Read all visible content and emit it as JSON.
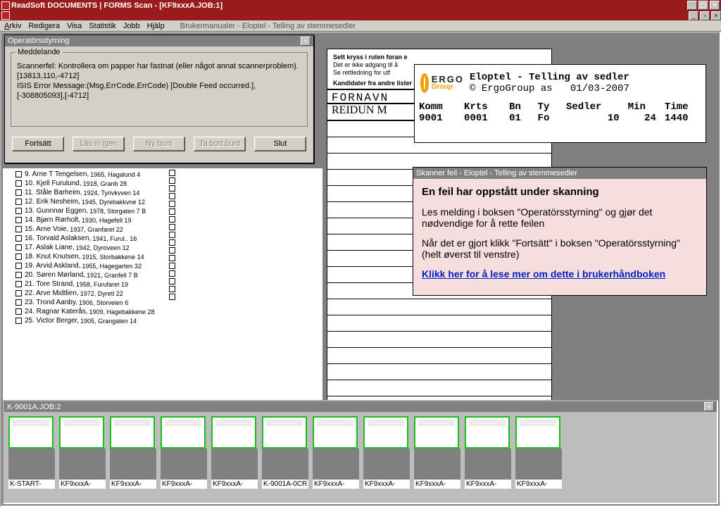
{
  "window": {
    "title": "ReadSoft DOCUMENTS | FORMS Scan - [KF9xxxA.JOB:1]"
  },
  "menu": {
    "arkiv": "Arkiv",
    "redigera": "Redigera",
    "visa": "Visa",
    "statistik": "Statistik",
    "jobb": "Jobb",
    "hjalp": "Hjälp",
    "help_trail": "Brukermanualer - Eloptel - Telling av stemmesedler"
  },
  "dialog": {
    "title": "Operatörsstyrning",
    "group_legend": "Meddelande",
    "msg1": "Scannerfel: Kontrollera om papper har fastnat (eller något annat scannerproblem).",
    "msg2": "[13813,110,-4712]",
    "msg3": "ISIS Error Message:(Msg,ErrCode,ErrCode) [Double Feed occurred.],[-308805093],[-4712]",
    "btn_fortsatt": "Fortsätt",
    "btn_lasin": "Läs in igen",
    "btn_nybunt": "Ny bunt",
    "btn_tabort": "Ta bort bunt",
    "btn_slut": "Slut"
  },
  "candidates": [
    {
      "n": "9",
      "name": "Arne T Tengelsen",
      "meta": "1965, Hagalund  4"
    },
    {
      "n": "10",
      "name": "Kjell Furulund",
      "meta": "1918, Granb  28"
    },
    {
      "n": "11",
      "name": "Ståle Barheim",
      "meta": "1924, Tyrivkvven  14"
    },
    {
      "n": "12",
      "name": "Erik Nesheim",
      "meta": "1945, Dyrebakkvne 12"
    },
    {
      "n": "13",
      "name": "Gunnnar Eggen",
      "meta": "1978, Storgaten  7 B"
    },
    {
      "n": "14",
      "name": "Bjørn Rørholt",
      "meta": "1930, Hagefell  19"
    },
    {
      "n": "15",
      "name": "Arne Voie",
      "meta": "1937, Granfaret  22"
    },
    {
      "n": "16",
      "name": "Torvald Aslaksen",
      "meta": "1941, Furul..  16"
    },
    {
      "n": "17",
      "name": "Aslak Liane",
      "meta": "1942, Dyroveen  12"
    },
    {
      "n": "18",
      "name": "Knut Knutsen",
      "meta": "1915, Storbakkene 14"
    },
    {
      "n": "19",
      "name": "Arvid Askland",
      "meta": "1955, Hagegarten  32"
    },
    {
      "n": "20",
      "name": "Søren Mørland",
      "meta": "1921, Granfell  7 B"
    },
    {
      "n": "21",
      "name": "Tore Strand",
      "meta": "1958, Furufaret  19"
    },
    {
      "n": "22",
      "name": "Arve Midtlien",
      "meta": "1972, Dyreti  22"
    },
    {
      "n": "23",
      "name": "Trond Aanby",
      "meta": "1906, Storveien  6"
    },
    {
      "n": "24",
      "name": "Ragnar Katerås",
      "meta": "1909, Hagebakkene 28"
    },
    {
      "n": "25",
      "name": "Victor Berger",
      "meta": "1905, Grangaten  14"
    }
  ],
  "form": {
    "instr1": "Sett kryss i ruten foran e",
    "instr2": "Det er ikke adgang til å",
    "instr3": "Se rettledning for utf",
    "instr4": "Kandidater fra andre lister",
    "col_header": "FORNAVN",
    "handwritten": "REIDUN M"
  },
  "ergo": {
    "brand1": "ERGO",
    "brand2": "Group",
    "line1": "Eloptel - Telling av sedler",
    "copyright": "© ErgoGroup as",
    "date": "01/03-2007",
    "cols": {
      "komm": "Komm",
      "krts": "Krts",
      "bn": "Bn",
      "ty": "Ty",
      "sedler": "Sedler",
      "min": "Min",
      "time": "Time"
    },
    "vals": {
      "komm": "9001",
      "krts": "0001",
      "bn": "01",
      "ty": "Fo",
      "sedler": "10",
      "min": "24",
      "time": "1440"
    }
  },
  "error": {
    "title": "Skanner feil - Eloptel - Telling av stemmesedler",
    "h": "En feil har oppstått under skanning",
    "p1": "Les melding i boksen \"Operatörsstyrning\" og gjør det nødvendige for å rette feilen",
    "p2": "Når det er gjort klikk \"Fortsätt\" i boksen \"Operatörsstyrning\" (helt øverst til venstre)",
    "link": "Klikk her for å lese mer om dette i brukerhåndboken"
  },
  "thumbs": {
    "title": "K-9001A.JOB:2",
    "items": [
      "K-START-",
      "KF9xxxA-",
      "KF9xxxA-",
      "KF9xxxA-",
      "KF9xxxA-",
      "K-9001A-0CR",
      "KF9xxxA-",
      "KF9xxxA-",
      "KF9xxxA-",
      "KF9xxxA-",
      "KF9xxxA-"
    ]
  }
}
